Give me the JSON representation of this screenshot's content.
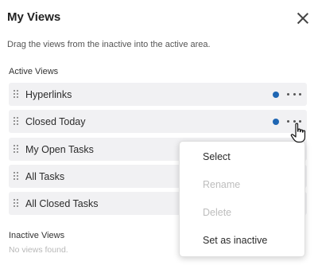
{
  "header": {
    "title": "My Views"
  },
  "description": "Drag the views from the inactive into the active area.",
  "active": {
    "label": "Active Views",
    "items": [
      {
        "label": "Hyperlinks",
        "indicator": true
      },
      {
        "label": "Closed Today",
        "indicator": true
      },
      {
        "label": "My Open Tasks",
        "indicator": false
      },
      {
        "label": "All Tasks",
        "indicator": false
      },
      {
        "label": "All Closed Tasks",
        "indicator": false
      }
    ]
  },
  "inactive": {
    "label": "Inactive Views",
    "empty_text": "No views found."
  },
  "context_menu": {
    "items": [
      {
        "label": "Select",
        "enabled": true
      },
      {
        "label": "Rename",
        "enabled": false
      },
      {
        "label": "Delete",
        "enabled": false
      },
      {
        "label": "Set as inactive",
        "enabled": true
      }
    ]
  },
  "colors": {
    "indicator": "#1f66b3",
    "row_bg": "#f1f1f3"
  }
}
